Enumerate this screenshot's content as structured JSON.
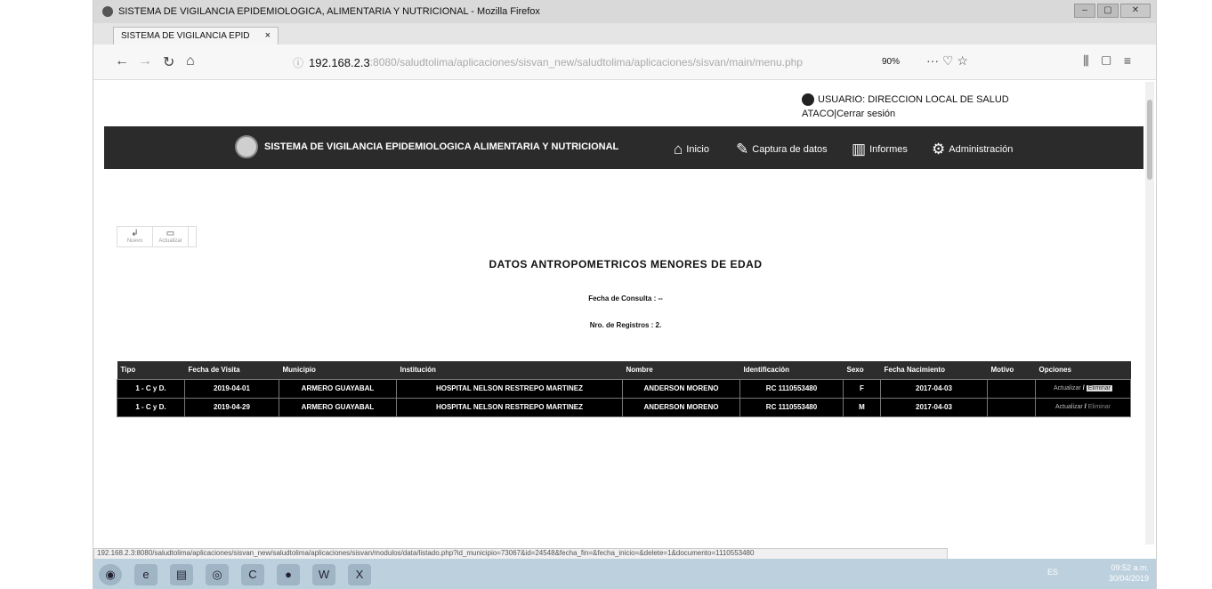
{
  "window": {
    "title": "SISTEMA DE VIGILANCIA EPIDEMIOLOGICA, ALIMENTARIA Y NUTRICIONAL - Mozilla Firefox",
    "tab_label": "SISTEMA DE VIGILANCIA EPID",
    "close_tab": "×"
  },
  "browser": {
    "url_host": "192.168.2.3",
    "url_path": ":8080/saludtolima/aplicaciones/sisvan_new/saludtolima/aplicaciones/sisvan/main/menu.php",
    "zoom": "90%",
    "page_actions": "··· ♡ ☆"
  },
  "user": {
    "line1": "USUARIO: DIRECCION LOCAL DE SALUD",
    "line2": "ATACO|Cerrar sesión"
  },
  "appbar": {
    "title": "SISTEMA DE VIGILANCIA EPIDEMIOLOGICA ALIMENTARIA Y NUTRICIONAL",
    "menu": {
      "inicio": "Inicio",
      "captura": "Captura de datos",
      "informes": "Informes",
      "admin": "Administración"
    }
  },
  "toolbar": {
    "nuevo": "Nuevo",
    "actualizar": "Actualizar"
  },
  "report": {
    "title": "DATOS ANTROPOMETRICOS MENORES DE EDAD",
    "fecha_consulta": "Fecha de Consulta : --",
    "nro_registros": "Nro. de Registros : 2."
  },
  "table": {
    "headers": [
      "Tipo",
      "Fecha de Visita",
      "Municipio",
      "Institución",
      "Nombre",
      "Identificación",
      "Sexo",
      "Fecha Nacimiento",
      "Motivo",
      "Opciones"
    ],
    "rows": [
      {
        "tipo": "1 - C y D.",
        "fecha": "2019-04-01",
        "municipio": "ARMERO GUAYABAL",
        "institucion": "HOSPITAL NELSON RESTREPO MARTINEZ",
        "nombre": "ANDERSON MORENO",
        "identificacion": "RC 1110553480",
        "sexo": "F",
        "nacimiento": "2017-04-03",
        "motivo": ""
      },
      {
        "tipo": "1 - C y D.",
        "fecha": "2019-04-29",
        "municipio": "ARMERO GUAYABAL",
        "institucion": "HOSPITAL NELSON RESTREPO MARTINEZ",
        "nombre": "ANDERSON MORENO",
        "identificacion": "RC 1110553480",
        "sexo": "M",
        "nacimiento": "2017-04-03",
        "motivo": ""
      }
    ],
    "opt_edit": "Actualizar",
    "opt_sep": "/",
    "opt_delete": "Eliminar"
  },
  "status_url": "192.168.2.3:8080/saludtolima/aplicaciones/sisvan_new/saludtolima/aplicaciones/sisvan/modulos/data/listado.php?id_municipio=73067&id=24548&fecha_fin=&fecha_inicio=&delete=1&documento=1110553480",
  "taskbar": {
    "lang": "ES",
    "time": "09:52 a.m.",
    "date": "30/04/2019"
  },
  "icons": [
    "firefox-icon",
    "back-icon",
    "forward-icon",
    "reload-icon",
    "home-icon",
    "user-icon",
    "home-menu-icon",
    "edit-icon",
    "chart-icon",
    "gear-icon"
  ]
}
